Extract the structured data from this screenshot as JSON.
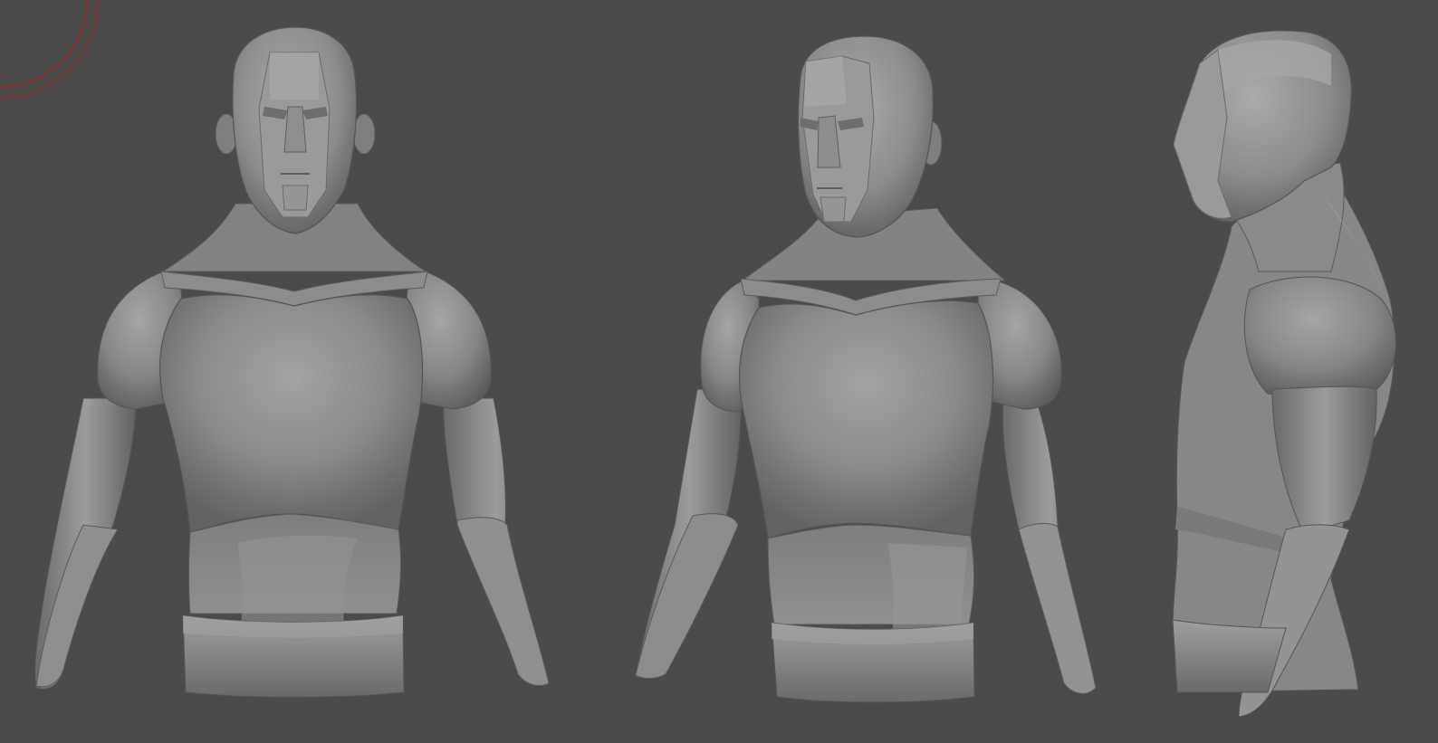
{
  "viewport": {
    "background_color": "#4b4b4b",
    "clay_color": "#8a8a8a",
    "clay_light": "#a9a9a9",
    "clay_dark": "#5e5e5e",
    "gizmo_color": "#9a2a2a"
  },
  "views": [
    {
      "id": "front",
      "kind": "bust-front-view"
    },
    {
      "id": "three-quarter",
      "kind": "bust-three-quarter-view"
    },
    {
      "id": "side",
      "kind": "bust-side-view"
    }
  ]
}
